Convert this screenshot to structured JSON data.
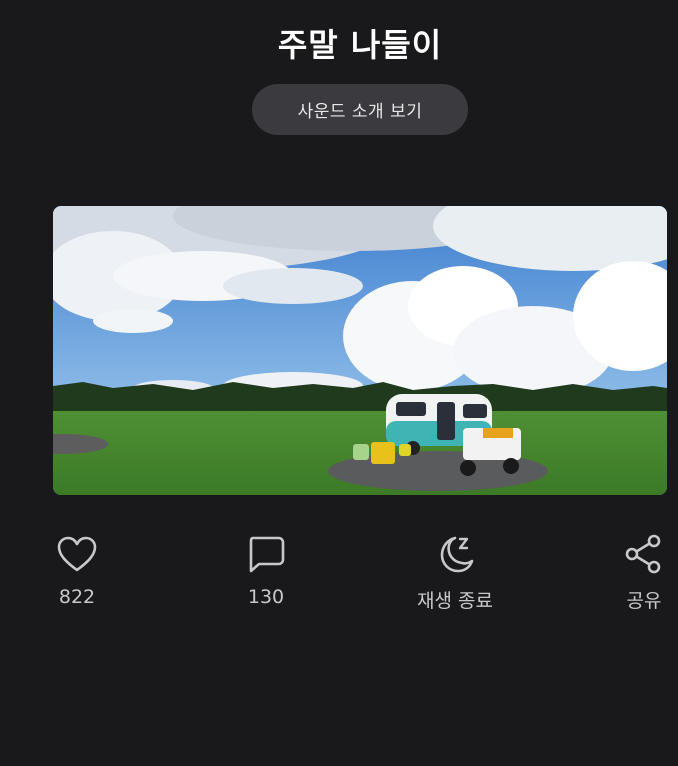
{
  "header": {
    "title": "주말 나들이",
    "sound_intro_label": "사운드 소개 보기"
  },
  "media": {
    "alt": "주말 나들이"
  },
  "actions": {
    "like_count": "822",
    "comment_count": "130",
    "sleep_label": "재생 종료",
    "share_label": "공유"
  }
}
